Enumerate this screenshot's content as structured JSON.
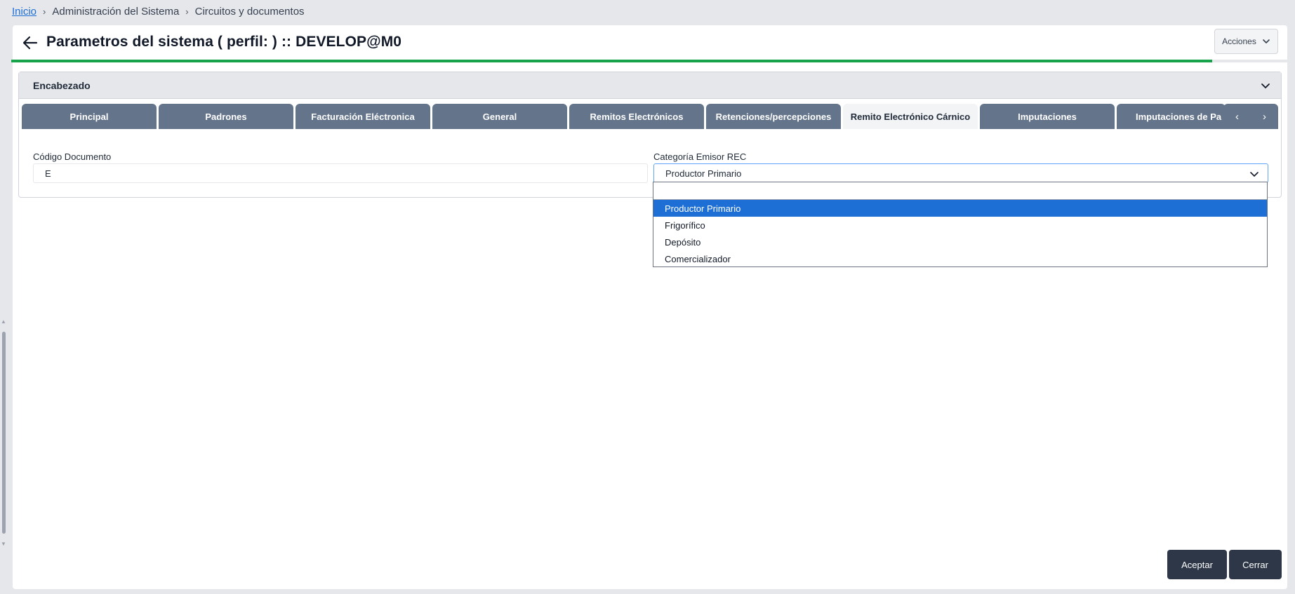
{
  "breadcrumb": {
    "home": "Inicio",
    "items": [
      "Administración del Sistema",
      "Circuitos y documentos"
    ],
    "separator": "›"
  },
  "header": {
    "title": "Parametros del sistema ( perfil: ) :: DEVELOP@M0",
    "actions_label": "Acciones",
    "progress": 0.94
  },
  "section": {
    "title": "Encabezado"
  },
  "tabs": [
    {
      "label": "Principal",
      "active": false
    },
    {
      "label": "Padrones",
      "active": false
    },
    {
      "label": "Facturación Eléctronica",
      "active": false
    },
    {
      "label": "General",
      "active": false
    },
    {
      "label": "Remitos Electrónicos",
      "active": false
    },
    {
      "label": "Retenciones/percepciones",
      "active": false
    },
    {
      "label": "Remito Electrónico Cárnico",
      "active": true
    },
    {
      "label": "Imputaciones",
      "active": false
    },
    {
      "label": "Imputaciones de Pa",
      "active": false
    }
  ],
  "tab_nav": {
    "prev": "‹",
    "next": "›"
  },
  "form": {
    "codigo_label": "Código Documento",
    "codigo_value": "E",
    "categoria_label": "Categoría Emisor REC",
    "categoria_value": "Productor Primario"
  },
  "dropdown": {
    "options": [
      "Productor Primario",
      "Frigorífico",
      "Depósito",
      "Comercializador"
    ],
    "selected_index": 0
  },
  "footer": {
    "accept_label": "Aceptar",
    "close_label": "Cerrar"
  },
  "colors": {
    "accent": "#1d6fd6",
    "progress": "#16a34a",
    "tab": "#64748b",
    "button": "#2d3748"
  }
}
